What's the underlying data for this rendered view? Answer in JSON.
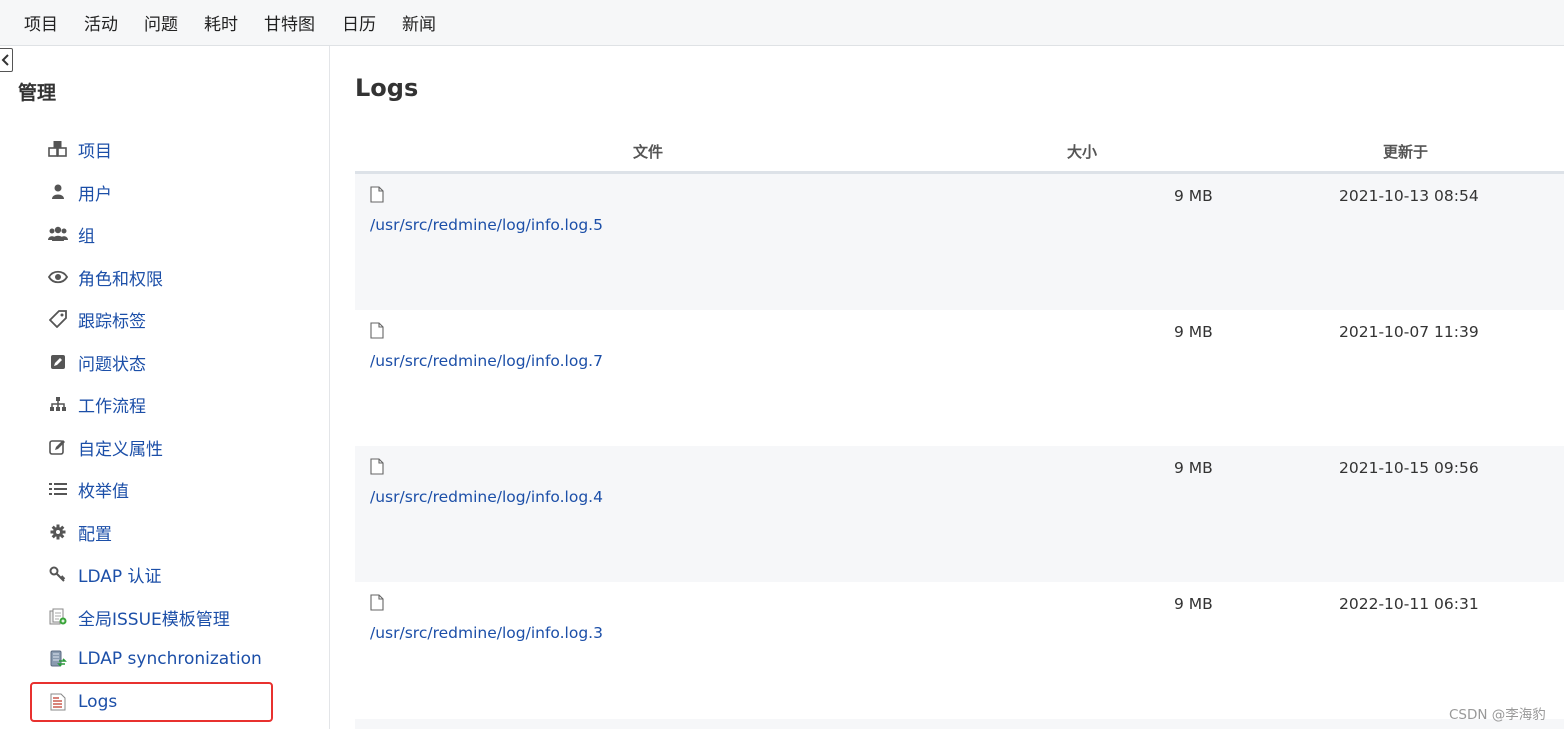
{
  "top_nav": [
    {
      "label": "项目"
    },
    {
      "label": "活动"
    },
    {
      "label": "问题"
    },
    {
      "label": "耗时"
    },
    {
      "label": "甘特图"
    },
    {
      "label": "日历"
    },
    {
      "label": "新闻"
    }
  ],
  "sidebar": {
    "title": "管理",
    "items": [
      {
        "label": "项目",
        "icon": "projects-icon"
      },
      {
        "label": "用户",
        "icon": "user-icon"
      },
      {
        "label": "组",
        "icon": "group-icon"
      },
      {
        "label": "角色和权限",
        "icon": "eye-icon"
      },
      {
        "label": "跟踪标签",
        "icon": "tag-icon"
      },
      {
        "label": "问题状态",
        "icon": "edit-square-icon"
      },
      {
        "label": "工作流程",
        "icon": "workflow-tree-icon"
      },
      {
        "label": "自定义属性",
        "icon": "pencil-square-icon"
      },
      {
        "label": "枚举值",
        "icon": "list-icon"
      },
      {
        "label": "配置",
        "icon": "gear-icon"
      },
      {
        "label": "LDAP 认证",
        "icon": "key-icon"
      },
      {
        "label": "全局ISSUE模板管理",
        "icon": "template-icon"
      },
      {
        "label": "LDAP synchronization",
        "icon": "server-sync-icon"
      },
      {
        "label": "Logs",
        "icon": "log-document-icon",
        "active": true
      }
    ]
  },
  "main": {
    "title": "Logs",
    "columns": [
      "文件",
      "大小",
      "更新于"
    ],
    "rows": [
      {
        "file": "/usr/src/redmine/log/info.log.5",
        "size": "9 MB",
        "updated": "2021-10-13 08:54"
      },
      {
        "file": "/usr/src/redmine/log/info.log.7",
        "size": "9 MB",
        "updated": "2021-10-07 11:39"
      },
      {
        "file": "/usr/src/redmine/log/info.log.4",
        "size": "9 MB",
        "updated": "2021-10-15 09:56"
      },
      {
        "file": "/usr/src/redmine/log/info.log.3",
        "size": "9 MB",
        "updated": "2022-10-11 06:31"
      }
    ]
  },
  "watermark": "CSDN @李海豹",
  "colors": {
    "link": "#1c4fa8",
    "highlight": "#e8312f",
    "row_alt": "#f6f7f9"
  }
}
